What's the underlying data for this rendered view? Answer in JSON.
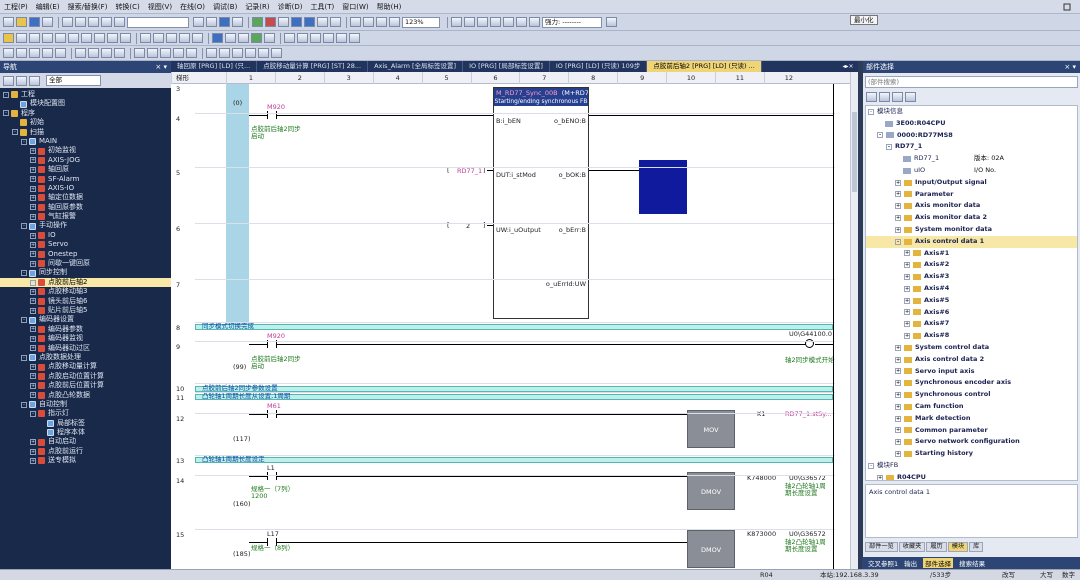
{
  "menu": [
    "工程(P)",
    "编辑(E)",
    "搜索/替换(F)",
    "转换(C)",
    "视图(V)",
    "在线(O)",
    "调试(B)",
    "记录(R)",
    "诊断(D)",
    "工具(T)",
    "窗口(W)",
    "帮助(H)"
  ],
  "toolbar": {
    "zoom": "123%",
    "signal_label": "强力: --------",
    "tooltip": "最小化"
  },
  "nav": {
    "title": "导航",
    "filter_label": "全部",
    "tree": [
      {
        "label": "工程",
        "depth": 0,
        "toggle": "-",
        "icon": "folder"
      },
      {
        "label": "模块配置图",
        "depth": 1,
        "toggle": "",
        "icon": "prg"
      },
      {
        "label": "程序",
        "depth": 0,
        "toggle": "-",
        "icon": "folder"
      },
      {
        "label": "初始",
        "depth": 1,
        "toggle": "",
        "icon": "folder"
      },
      {
        "label": "扫描",
        "depth": 1,
        "toggle": "-",
        "icon": "folder"
      },
      {
        "label": "MAIN",
        "depth": 2,
        "toggle": "-",
        "icon": "prg"
      },
      {
        "label": "初始监视",
        "depth": 3,
        "toggle": "+",
        "icon": "red"
      },
      {
        "label": "AXIS-JOG",
        "depth": 3,
        "toggle": "+",
        "icon": "red"
      },
      {
        "label": "轴回原",
        "depth": 3,
        "toggle": "+",
        "icon": "red"
      },
      {
        "label": "SF-Alarm",
        "depth": 3,
        "toggle": "+",
        "icon": "red"
      },
      {
        "label": "AXIS-IO",
        "depth": 3,
        "toggle": "+",
        "icon": "red"
      },
      {
        "label": "轴定位数据",
        "depth": 3,
        "toggle": "+",
        "icon": "red"
      },
      {
        "label": "轴回原参数",
        "depth": 3,
        "toggle": "+",
        "icon": "red"
      },
      {
        "label": "气缸报警",
        "depth": 3,
        "toggle": "+",
        "icon": "red"
      },
      {
        "label": "手动操作",
        "depth": 2,
        "toggle": "-",
        "icon": "prg"
      },
      {
        "label": "IO",
        "depth": 3,
        "toggle": "+",
        "icon": "red"
      },
      {
        "label": "Servo",
        "depth": 3,
        "toggle": "+",
        "icon": "red"
      },
      {
        "label": "Onestep",
        "depth": 3,
        "toggle": "+",
        "icon": "red"
      },
      {
        "label": "间歇一键回原",
        "depth": 3,
        "toggle": "+",
        "icon": "red"
      },
      {
        "label": "同步控制",
        "depth": 2,
        "toggle": "-",
        "icon": "prg"
      },
      {
        "label": "点胶前后轴2",
        "depth": 3,
        "toggle": "+",
        "icon": "red",
        "selected": true
      },
      {
        "label": "点胶移动轴3",
        "depth": 3,
        "toggle": "+",
        "icon": "red"
      },
      {
        "label": "镜头前后轴6",
        "depth": 3,
        "toggle": "+",
        "icon": "red"
      },
      {
        "label": "贴片前后轴5",
        "depth": 3,
        "toggle": "+",
        "icon": "red"
      },
      {
        "label": "编码器设置",
        "depth": 2,
        "toggle": "-",
        "icon": "prg"
      },
      {
        "label": "编码器参数",
        "depth": 3,
        "toggle": "+",
        "icon": "red"
      },
      {
        "label": "编码器监视",
        "depth": 3,
        "toggle": "+",
        "icon": "red"
      },
      {
        "label": "编码器动过区",
        "depth": 3,
        "toggle": "+",
        "icon": "red"
      },
      {
        "label": "点胶数据处理",
        "depth": 2,
        "toggle": "-",
        "icon": "prg"
      },
      {
        "label": "点胶移动量计算",
        "depth": 3,
        "toggle": "+",
        "icon": "red"
      },
      {
        "label": "点胶启动位置计算",
        "depth": 3,
        "toggle": "+",
        "icon": "red"
      },
      {
        "label": "点胶前后位置计算",
        "depth": 3,
        "toggle": "+",
        "icon": "red"
      },
      {
        "label": "点胶凸轮数据",
        "depth": 3,
        "toggle": "+",
        "icon": "red"
      },
      {
        "label": "自动控制",
        "depth": 2,
        "toggle": "-",
        "icon": "prg"
      },
      {
        "label": "指示灯",
        "depth": 3,
        "toggle": "-",
        "icon": "red"
      },
      {
        "label": "局部标签",
        "depth": 4,
        "toggle": "",
        "icon": "prg"
      },
      {
        "label": "程序本体",
        "depth": 4,
        "toggle": "",
        "icon": "prg"
      },
      {
        "label": "自动启动",
        "depth": 3,
        "toggle": "+",
        "icon": "red"
      },
      {
        "label": "点胶前运行",
        "depth": 3,
        "toggle": "+",
        "icon": "red"
      },
      {
        "label": "送专模拟",
        "depth": 3,
        "toggle": "+",
        "icon": "red"
      }
    ]
  },
  "tabs": [
    {
      "label": "轴回原 [PRG] [LD] (只..."
    },
    {
      "label": "点胶移动量计算 [PRG] [ST] 28..."
    },
    {
      "label": "Axis_Alarm [全局标签设置]"
    },
    {
      "label": "IO [PRG] [局部标签设置]"
    },
    {
      "label": "IO [PRG] [LD] (只读) 109步"
    },
    {
      "label": "点胶前后轴2 [PRG] [LD] (只读) ...",
      "active": true
    }
  ],
  "ladder": {
    "header_first": "梯形",
    "columns": [
      "1",
      "2",
      "3",
      "4",
      "5",
      "6",
      "7",
      "8",
      "9",
      "10",
      "11",
      "12"
    ],
    "steps": [
      {
        "row": "3",
        "step": "(0)"
      },
      {
        "row": "4",
        "step": ""
      },
      {
        "row": "5",
        "step": ""
      },
      {
        "row": "6",
        "step": ""
      },
      {
        "row": "7",
        "step": ""
      },
      {
        "row": "8",
        "step": ""
      },
      {
        "row": "9",
        "step": "(99)"
      },
      {
        "row": "10",
        "step": ""
      },
      {
        "row": "11",
        "step": ""
      },
      {
        "row": "12",
        "step": "(117)"
      },
      {
        "row": "13",
        "step": ""
      },
      {
        "row": "14",
        "step": "(160)"
      },
      {
        "row": "15",
        "step": "(185)"
      }
    ],
    "fb": {
      "instance": "M_RD77_Sync_00B",
      "type": "(M+RD77",
      "subtitle": "Starting/ending synchronous FB",
      "in1": "B:i_bEN",
      "out1": "o_bENO:B",
      "in2": "DUT:i_stMod",
      "out2": "o_bOK:B",
      "in3": "UW:i_uOutput",
      "out3": "o_bErr:B",
      "out4": "o_uErrId:UW",
      "arg_module": "RD77_1",
      "arg_axis": "2"
    },
    "r4_contact": "M920",
    "r4_comment": "点胶前后轴2同步启动",
    "sec8": "同步模式切换完成",
    "r9_contact": "M920",
    "r9_comment": "点胶前后轴2同步启动",
    "r9_coil": "U0\\G44100.0",
    "r9_coil_comment": "轴2同步模式开始",
    "sec10": "点胶前后轴2同步参数设置",
    "sec11": "凸轮轴1周期长度从设置,1周期",
    "r12_contact": "M61",
    "r12_instr": "MOV",
    "r12_src": "K1",
    "r12_dst": "RD77_1.stSy...",
    "sec13": "凸轮轴1周期长度设定",
    "r14_contact": "L1",
    "r14_comment": "规格一（7列）\n1200",
    "r14_instr": "DMOV",
    "r14_src": "K748000",
    "r14_dst": "U0\\G36572",
    "r14_dst_comment": "轴2凸轮轴1周\n期长度设置",
    "r15_contact": "L17",
    "r15_comment": "规格一（8列）",
    "r15_instr": "DMOV",
    "r15_src": "K873000",
    "r15_dst": "U0\\G36572",
    "r15_dst_comment": "轴2凸轮轴1周\n期长度设置"
  },
  "parts": {
    "title": "部件选择",
    "search_placeholder": "(部件搜索)",
    "tree": [
      {
        "label": "模块信息",
        "depth": 0,
        "toggle": "-",
        "kind": "none",
        "bold": false
      },
      {
        "label": "3E00:R04CPU",
        "depth": 1,
        "toggle": "",
        "kind": "mod",
        "bold": true
      },
      {
        "label": "0000:RD77MS8",
        "depth": 1,
        "toggle": "-",
        "kind": "mod",
        "bold": true
      },
      {
        "label": "RD77_1",
        "depth": 2,
        "toggle": "-",
        "kind": "none",
        "bold": true
      },
      {
        "label": "RD77_1",
        "depth": 3,
        "toggle": "",
        "kind": "mod",
        "bold": false,
        "extra": "版本: 02A"
      },
      {
        "label": "uIO",
        "depth": 3,
        "toggle": "",
        "kind": "mod",
        "bold": false,
        "extra": "I/O No."
      },
      {
        "label": "Input/Output signal",
        "depth": 3,
        "toggle": "+",
        "kind": "fld",
        "bold": true
      },
      {
        "label": "Parameter",
        "depth": 3,
        "toggle": "+",
        "kind": "fld",
        "bold": true
      },
      {
        "label": "Axis monitor data",
        "depth": 3,
        "toggle": "+",
        "kind": "fld",
        "bold": true
      },
      {
        "label": "Axis monitor data 2",
        "depth": 3,
        "toggle": "+",
        "kind": "fld",
        "bold": true
      },
      {
        "label": "System monitor data",
        "depth": 3,
        "toggle": "+",
        "kind": "fld",
        "bold": true
      },
      {
        "label": "Axis control data 1",
        "depth": 3,
        "toggle": "-",
        "kind": "fld",
        "bold": true,
        "selected": true
      },
      {
        "label": "Axis#1",
        "depth": 4,
        "toggle": "+",
        "kind": "fld",
        "bold": true
      },
      {
        "label": "Axis#2",
        "depth": 4,
        "toggle": "+",
        "kind": "fld",
        "bold": true
      },
      {
        "label": "Axis#3",
        "depth": 4,
        "toggle": "+",
        "kind": "fld",
        "bold": true
      },
      {
        "label": "Axis#4",
        "depth": 4,
        "toggle": "+",
        "kind": "fld",
        "bold": true
      },
      {
        "label": "Axis#5",
        "depth": 4,
        "toggle": "+",
        "kind": "fld",
        "bold": true
      },
      {
        "label": "Axis#6",
        "depth": 4,
        "toggle": "+",
        "kind": "fld",
        "bold": true
      },
      {
        "label": "Axis#7",
        "depth": 4,
        "toggle": "+",
        "kind": "fld",
        "bold": true
      },
      {
        "label": "Axis#8",
        "depth": 4,
        "toggle": "+",
        "kind": "fld",
        "bold": true
      },
      {
        "label": "System control data",
        "depth": 3,
        "toggle": "+",
        "kind": "fld",
        "bold": true
      },
      {
        "label": "Axis control data 2",
        "depth": 3,
        "toggle": "+",
        "kind": "fld",
        "bold": true
      },
      {
        "label": "Servo input axis",
        "depth": 3,
        "toggle": "+",
        "kind": "fld",
        "bold": true
      },
      {
        "label": "Synchronous encoder axis",
        "depth": 3,
        "toggle": "+",
        "kind": "fld",
        "bold": true
      },
      {
        "label": "Synchronous control",
        "depth": 3,
        "toggle": "+",
        "kind": "fld",
        "bold": true
      },
      {
        "label": "Cam function",
        "depth": 3,
        "toggle": "+",
        "kind": "fld",
        "bold": true
      },
      {
        "label": "Mark detection",
        "depth": 3,
        "toggle": "+",
        "kind": "fld",
        "bold": true
      },
      {
        "label": "Common parameter",
        "depth": 3,
        "toggle": "+",
        "kind": "fld",
        "bold": true
      },
      {
        "label": "Servo network configuration",
        "depth": 3,
        "toggle": "+",
        "kind": "fld",
        "bold": true
      },
      {
        "label": "Starting history",
        "depth": 3,
        "toggle": "+",
        "kind": "fld",
        "bold": true
      },
      {
        "label": "模块FB",
        "depth": 0,
        "toggle": "-",
        "kind": "none",
        "bold": false
      },
      {
        "label": "R04CPU",
        "depth": 1,
        "toggle": "+",
        "kind": "fld",
        "bold": true
      }
    ],
    "description": "Axis control data 1",
    "tabs": [
      {
        "label": "部件一览"
      },
      {
        "label": "收藏夹"
      },
      {
        "label": "履历"
      },
      {
        "label": "模块",
        "active": true
      },
      {
        "label": "库"
      }
    ]
  },
  "bottom_tabs": [
    {
      "label": "交叉参照1"
    },
    {
      "label": "输出"
    },
    {
      "label": "部件选择",
      "active": true
    },
    {
      "label": "搜索结果"
    }
  ],
  "status": {
    "cpu": "R04",
    "station": "本站:192.168.3.39",
    "steps": "/533步",
    "mode": "改写",
    "size": "大写",
    "num": "数字"
  }
}
